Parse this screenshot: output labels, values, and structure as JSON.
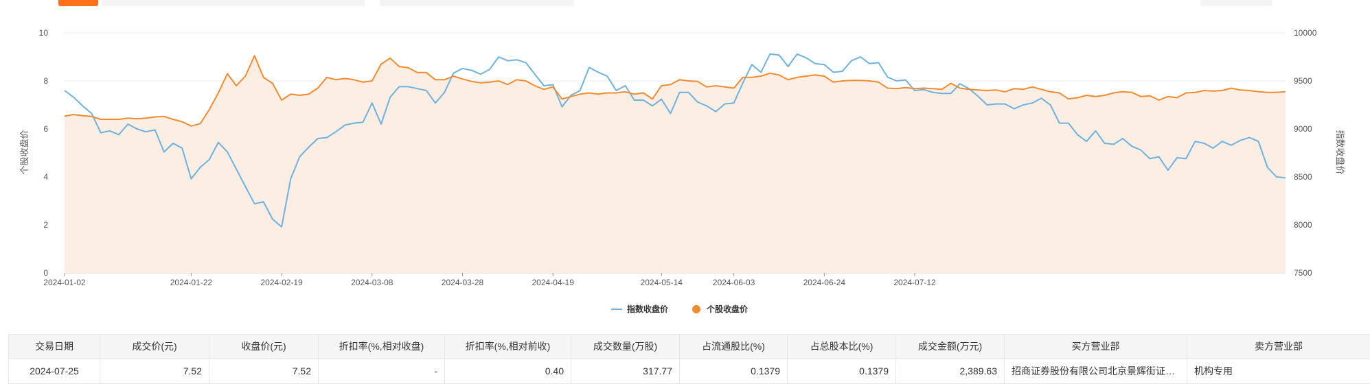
{
  "colors": {
    "index_line": "#6cb2e0",
    "stock_line": "#f28a2e",
    "area_fill": "#fdeee4",
    "grid": "#e8e8e8"
  },
  "chart_data": {
    "type": "line",
    "ylabel_left": "个股收盘价",
    "ylabel_right": "指数收盘价",
    "ylim_left": [
      0,
      10
    ],
    "ylim_right": [
      7500,
      10000
    ],
    "yticks_left": [
      "0",
      "2",
      "4",
      "6",
      "8",
      "10"
    ],
    "yticks_right": [
      "7500",
      "8000",
      "8500",
      "9000",
      "9500",
      "10000"
    ],
    "xtick_labels": [
      "2024-01-02",
      "2024-01-22",
      "2024-02-19",
      "2024-03-08",
      "2024-03-28",
      "2024-04-19",
      "2024-05-14",
      "2024-06-03",
      "2024-06-24",
      "2024-07-12"
    ],
    "xtick_positions": [
      0,
      14,
      24,
      34,
      44,
      54,
      66,
      74,
      84,
      94
    ],
    "legend_position": "bottom-center",
    "grid": true,
    "series": [
      {
        "name": "指数收盘价",
        "axis": "right",
        "values": [
          9400,
          9330,
          9240,
          9160,
          8960,
          8980,
          8940,
          9050,
          9000,
          8970,
          8990,
          8760,
          8850,
          8800,
          8480,
          8600,
          8680,
          8860,
          8760,
          8580,
          8400,
          8220,
          8240,
          8060,
          7980,
          8480,
          8710,
          8810,
          8900,
          8910,
          8970,
          9040,
          9060,
          9070,
          9270,
          9050,
          9330,
          9440,
          9440,
          9420,
          9400,
          9270,
          9380,
          9580,
          9630,
          9610,
          9570,
          9620,
          9750,
          9710,
          9720,
          9690,
          9570,
          9450,
          9460,
          9230,
          9350,
          9400,
          9640,
          9590,
          9550,
          9400,
          9450,
          9300,
          9300,
          9240,
          9310,
          9160,
          9380,
          9380,
          9280,
          9240,
          9180,
          9260,
          9270,
          9480,
          9670,
          9590,
          9780,
          9770,
          9650,
          9780,
          9740,
          9680,
          9670,
          9590,
          9600,
          9710,
          9750,
          9680,
          9690,
          9540,
          9500,
          9510,
          9400,
          9410,
          9380,
          9370,
          9370,
          9470,
          9420,
          9340,
          9250,
          9260,
          9260,
          9210,
          9250,
          9270,
          9320,
          9250,
          9060,
          9060,
          8940,
          8870,
          8980,
          8850,
          8840,
          8900,
          8820,
          8780,
          8690,
          8710,
          8570,
          8700,
          8690,
          8870,
          8850,
          8800,
          8870,
          8830,
          8880,
          8910,
          8870,
          8600,
          8500,
          8490
        ]
      },
      {
        "name": "个股收盘价",
        "axis": "left",
        "values": [
          6.53,
          6.6,
          6.55,
          6.52,
          6.4,
          6.4,
          6.4,
          6.45,
          6.42,
          6.45,
          6.5,
          6.52,
          6.4,
          6.3,
          6.12,
          6.22,
          6.8,
          7.5,
          8.3,
          7.8,
          8.2,
          9.05,
          8.15,
          7.9,
          7.2,
          7.45,
          7.4,
          7.45,
          7.7,
          8.15,
          8.05,
          8.1,
          8.05,
          7.95,
          8.0,
          8.7,
          8.95,
          8.6,
          8.55,
          8.35,
          8.35,
          8.05,
          8.05,
          8.2,
          8.08,
          7.98,
          7.92,
          7.95,
          8.0,
          7.85,
          8.05,
          8.0,
          7.8,
          7.65,
          7.75,
          7.25,
          7.35,
          7.45,
          7.5,
          7.45,
          7.5,
          7.5,
          7.55,
          7.45,
          7.5,
          7.25,
          7.8,
          7.85,
          8.05,
          8.0,
          7.98,
          7.75,
          7.8,
          7.75,
          7.7,
          8.15,
          8.15,
          8.2,
          8.32,
          8.25,
          8.05,
          8.15,
          8.2,
          8.25,
          8.2,
          7.95,
          8.0,
          8.02,
          8.02,
          8.0,
          7.95,
          7.7,
          7.68,
          7.72,
          7.68,
          7.7,
          7.68,
          7.65,
          7.9,
          7.7,
          7.65,
          7.62,
          7.6,
          7.62,
          7.55,
          7.68,
          7.65,
          7.75,
          7.65,
          7.55,
          7.5,
          7.25,
          7.3,
          7.4,
          7.35,
          7.4,
          7.5,
          7.55,
          7.52,
          7.35,
          7.38,
          7.2,
          7.35,
          7.3,
          7.5,
          7.52,
          7.6,
          7.58,
          7.6,
          7.7,
          7.62,
          7.6,
          7.55,
          7.52,
          7.52,
          7.55
        ]
      }
    ]
  },
  "table": {
    "headers": [
      "交易日期",
      "成交价(元)",
      "收盘价(元)",
      "折扣率(%,相对收盘)",
      "折扣率(%,相对前收)",
      "成交数量(万股)",
      "占流通股比(%)",
      "占总股本比(%)",
      "成交金额(万元)",
      "买方营业部",
      "卖方营业部"
    ],
    "row": {
      "date": "2024-07-25",
      "deal_price": "7.52",
      "close_price": "7.52",
      "discount_close": "-",
      "discount_prev": "0.40",
      "volume": "317.77",
      "float_ratio": "0.1379",
      "total_ratio": "0.1379",
      "amount": "2,389.63",
      "buyer": "招商证券股份有限公司北京景辉街证券营业部",
      "seller": "机构专用"
    }
  }
}
